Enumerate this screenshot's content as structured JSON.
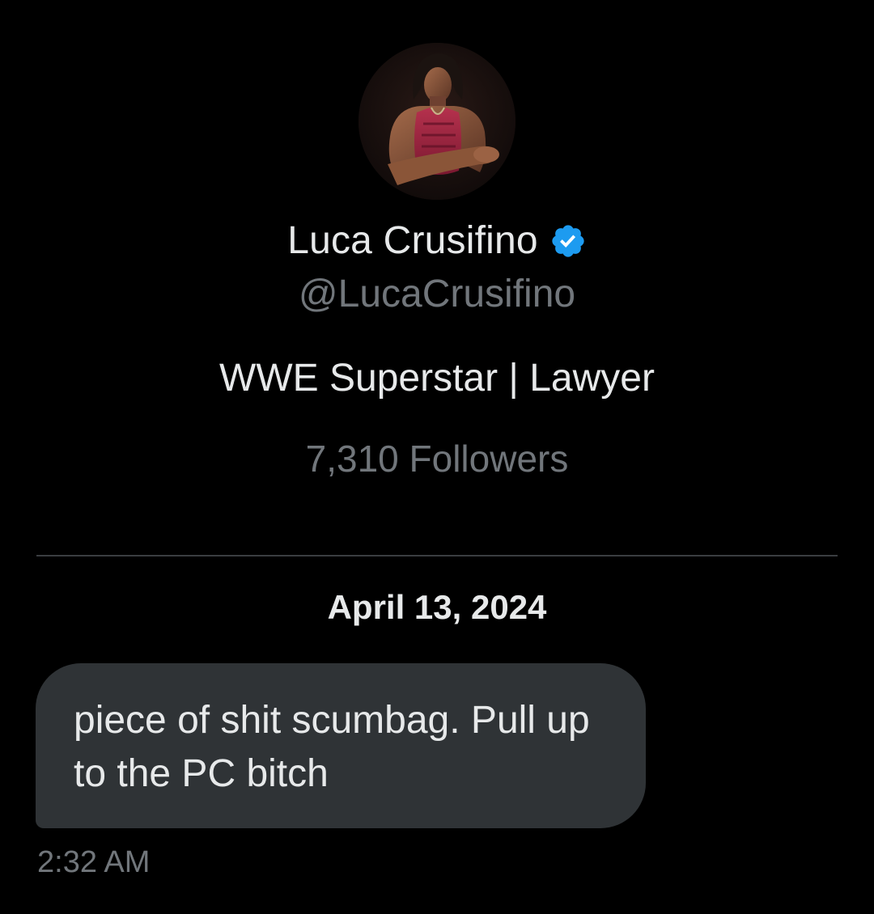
{
  "profile": {
    "avatar_icon": "profile-photo",
    "display_name": "Luca Crusifino",
    "verified_icon": "verified-badge-icon",
    "handle": "@LucaCrusifino",
    "bio": "WWE Superstar | Lawyer",
    "followers": "7,310 Followers"
  },
  "conversation": {
    "date_separator": "April 13, 2024",
    "messages": [
      {
        "text": "piece of shit scumbag. Pull up to the PC bitch",
        "time": "2:32 AM"
      }
    ]
  },
  "colors": {
    "background": "#000000",
    "primary_text": "#e7e9ea",
    "secondary_text": "#71767b",
    "bubble": "#2f3336",
    "verified": "#1d9bf0"
  }
}
